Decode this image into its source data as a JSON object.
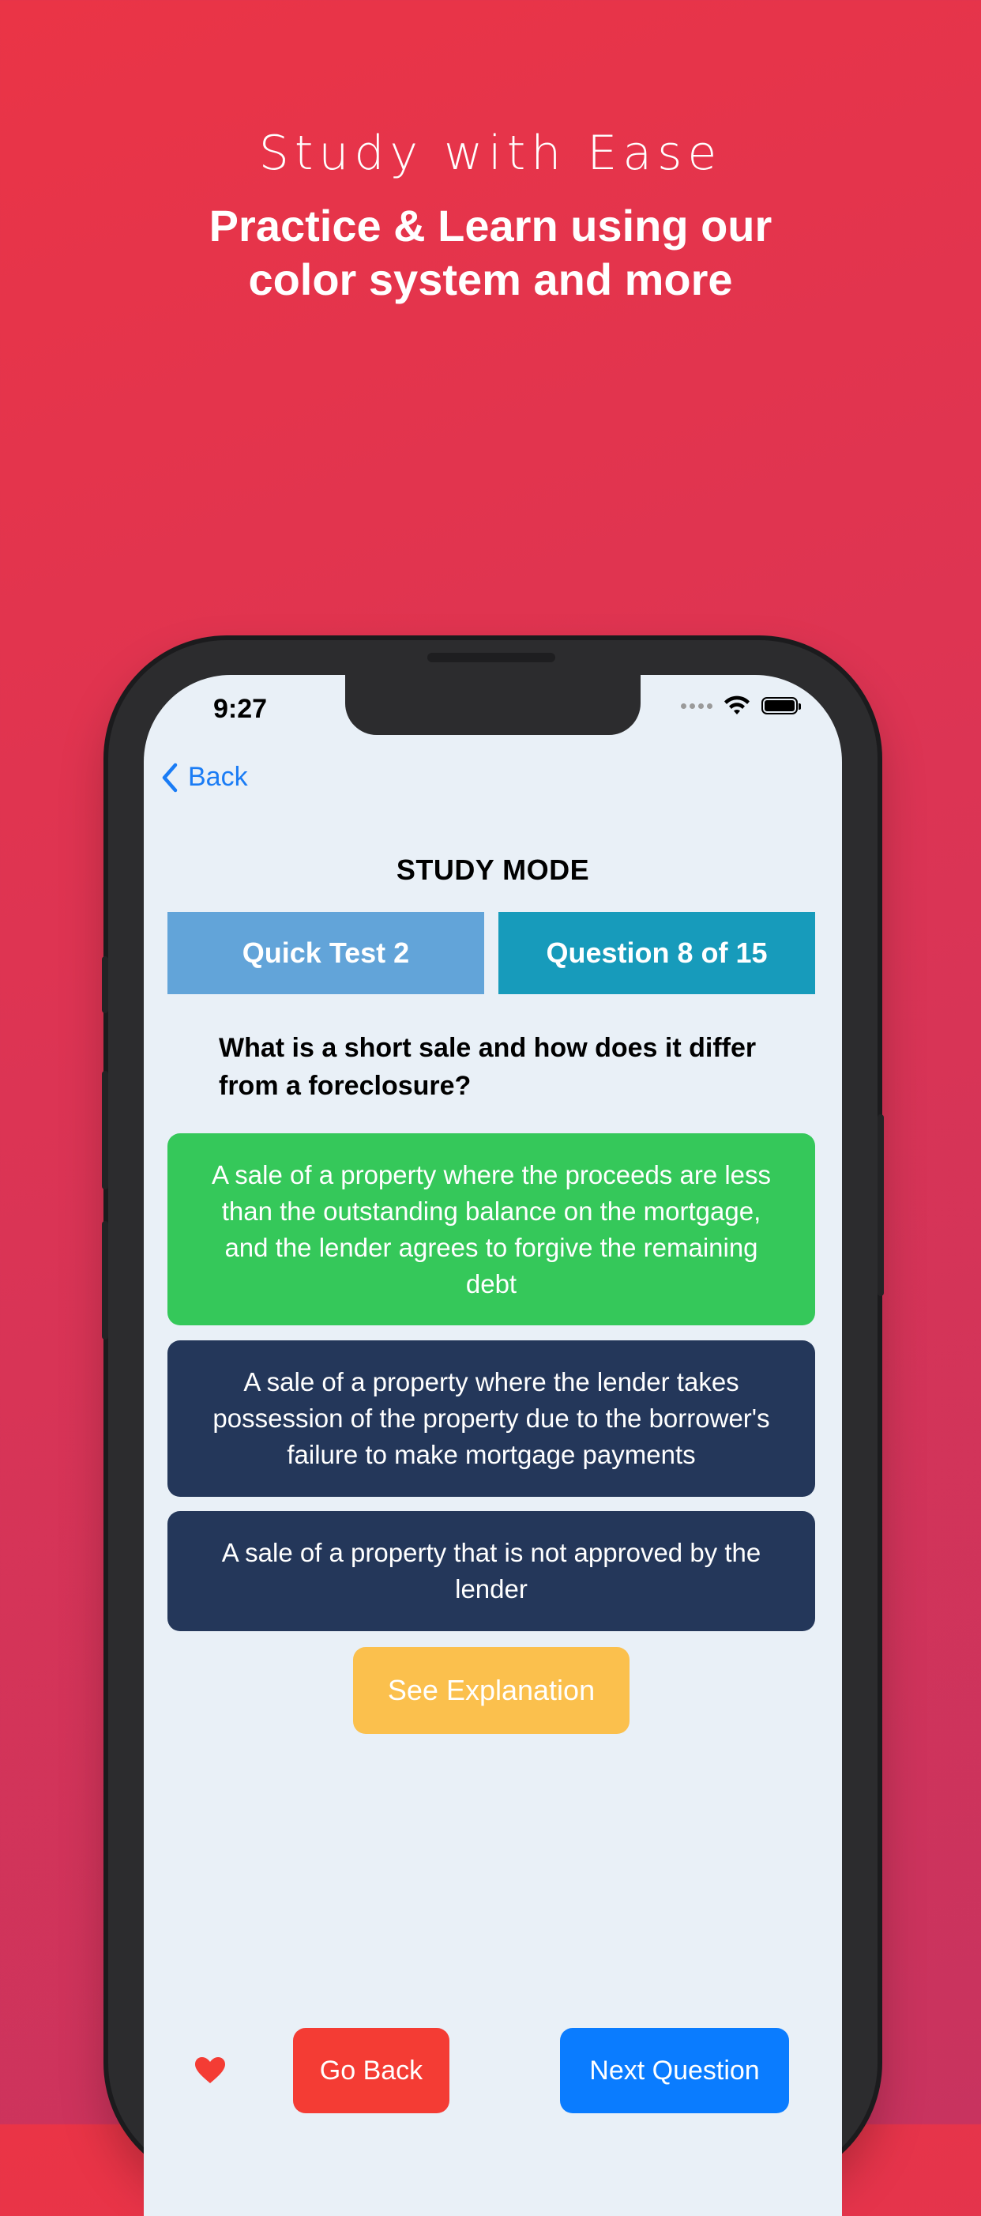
{
  "promo": {
    "title": "Study with Ease",
    "subtitle": "Practice & Learn using our color system and more"
  },
  "status_bar": {
    "time": "9:27"
  },
  "nav": {
    "back_label": "Back"
  },
  "page": {
    "title": "STUDY MODE",
    "test_name": "Quick Test 2",
    "question_counter": "Question 8 of 15"
  },
  "question": {
    "text": "What is a short sale and how does it differ from a foreclosure?"
  },
  "answers": [
    {
      "text": "A sale of a property where the proceeds are less than the outstanding balance on the mortgage, and the lender agrees to forgive the remaining debt",
      "state": "correct",
      "color": "#35c85a"
    },
    {
      "text": "A sale of a property where the lender takes possession of the property due to the borrower's failure to make mortgage payments",
      "state": "unselected",
      "color": "#24375a"
    },
    {
      "text": "A sale of a property that is not approved by the lender",
      "state": "unselected",
      "color": "#24375a"
    }
  ],
  "actions": {
    "explanation_label": "See Explanation",
    "go_back_label": "Go Back",
    "next_label": "Next Question",
    "favorite_icon": "heart-icon"
  },
  "colors": {
    "explanation": "#fbc04d",
    "go_back": "#f43c34",
    "next": "#0a7cff",
    "test_box": "#62a4d9",
    "counter_box": "#179bbb",
    "link": "#1a7cf5"
  }
}
